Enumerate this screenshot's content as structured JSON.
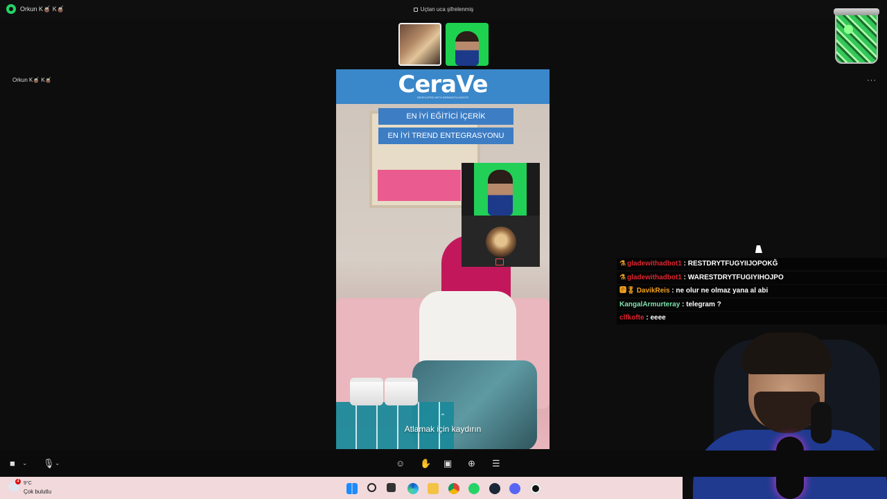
{
  "titlebar": {
    "app_title": "Orkun K🧉 K🧉",
    "encryption_label": "Uçtan uca şifrelenmiş"
  },
  "stage": {
    "presenter_name": "Orkun K🧉 K🧉",
    "more_menu": "···"
  },
  "video": {
    "brand": "CeraVe",
    "brand_sub": "DEVELOPED WITH DERMATOLOGISTS",
    "label_1": "EN İYİ EĞİTİCİ İÇERİK",
    "label_2": "EN İYİ TREND ENTEGRASYONU",
    "swipe_chevron": "⌃",
    "swipe_text": "Atlamak için kaydırın"
  },
  "chat": {
    "messages": [
      {
        "badge": "⚗",
        "user": "gladewithadbot1",
        "user_color": "#e0242e",
        "text": " : RESTDRYTFUGYIIJOPOKĞ"
      },
      {
        "badge": "⚗",
        "user": "gladewithadbot1",
        "user_color": "#e0242e",
        "text": " : WARESTDRYTFUGIYIHOJPO"
      },
      {
        "badge": "🅿🎖",
        "user": "DavikReis",
        "user_color": "#f3a21b",
        "text": " : ne olur ne olmaz yana al abi"
      },
      {
        "badge": "",
        "user": "KangalArmurteray",
        "user_color": "#7fe3b0",
        "text": " : telegram ?"
      },
      {
        "badge": "",
        "user": "clfkofte",
        "user_color": "#e0242e",
        "text": " : eeee"
      }
    ]
  },
  "taskbar": {
    "weather_badge": "4",
    "weather_temp": "9°C",
    "weather_desc": "Çok bulutlu"
  },
  "colors": {
    "whatsapp_green": "#25d366",
    "brand_blue": "#3a87c9",
    "chroma_green": "#22cf57"
  },
  "icons": {
    "controls": [
      "camera-icon",
      "chevron-down-icon",
      "microphone-icon",
      "chevron-down-icon",
      "emoji-icon",
      "raise-hand-icon",
      "screen-share-icon",
      "add-person-icon",
      "more-options-icon"
    ],
    "taskbar": [
      "start-icon",
      "search-icon",
      "task-view-icon",
      "edge-icon",
      "file-explorer-icon",
      "chrome-icon",
      "whatsapp-icon",
      "steam-icon",
      "discord-icon",
      "obs-icon"
    ]
  }
}
